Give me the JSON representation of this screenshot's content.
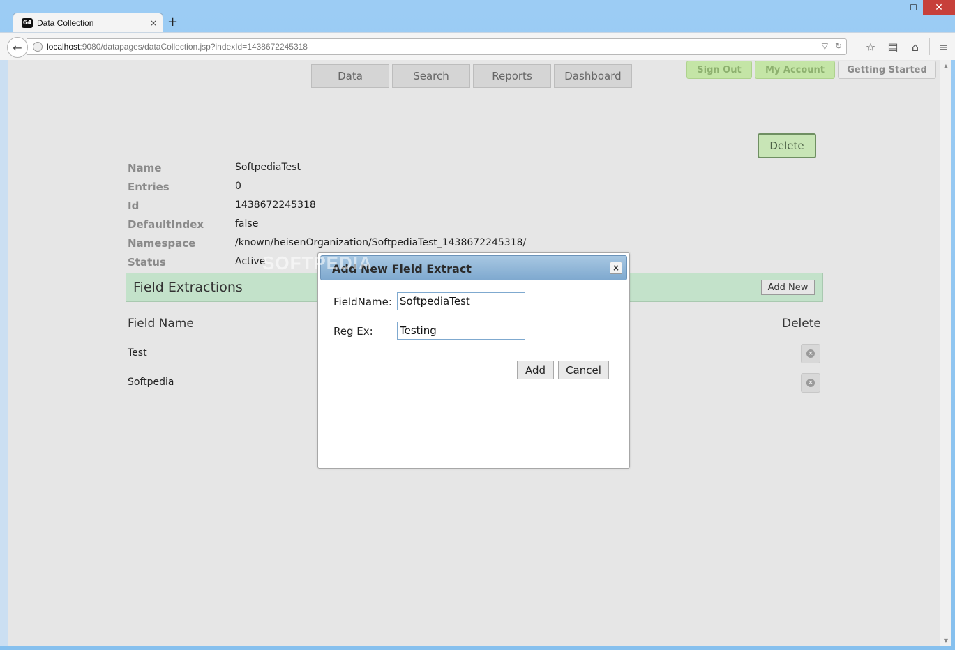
{
  "browser": {
    "tab_title": "Data Collection",
    "tab_favicon_text": "64",
    "new_tab": "+",
    "tab_close": "×",
    "url_host": "localhost",
    "url_rest": ":9080/datapages/dataCollection.jsp?indexId=1438672245318",
    "window_controls": {
      "minimize": "‒",
      "maximize": "☐",
      "close": "✕"
    }
  },
  "nav": {
    "tabs": [
      "Data",
      "Search",
      "Reports",
      "Dashboard"
    ],
    "sign_out": "Sign Out",
    "my_account": "My Account",
    "getting_started": "Getting Started"
  },
  "index": {
    "delete_label": "Delete",
    "rows": [
      {
        "label": "Name",
        "value": "SoftpediaTest"
      },
      {
        "label": "Entries",
        "value": "0"
      },
      {
        "label": "Id",
        "value": "1438672245318"
      },
      {
        "label": "DefaultIndex",
        "value": "false"
      },
      {
        "label": "Namespace",
        "value": "/known/heisenOrganization/SoftpediaTest_1438672245318/"
      },
      {
        "label": "Status",
        "value": "Active"
      }
    ]
  },
  "field_extractions": {
    "title": "Field Extractions",
    "add_new": "Add New",
    "col_field_name": "Field Name",
    "col_delete": "Delete",
    "rows": [
      "Test",
      "Softpedia"
    ]
  },
  "modal": {
    "title": "Add New Field Extract",
    "close": "×",
    "fieldname_label": "FieldName:",
    "fieldname_value": "SoftpediaTest",
    "regex_label": "Reg Ex:",
    "regex_value": "Testing",
    "add_label": "Add",
    "cancel_label": "Cancel"
  },
  "watermark": "SOFTPEDIA",
  "icons": {
    "back": "back-arrow-icon",
    "globe": "globe-icon",
    "dropdown": "dropdown-arrow-icon",
    "reload": "reload-icon",
    "bookmark": "star-icon",
    "reading_list": "reading-list-icon",
    "home": "home-icon",
    "menu": "hamburger-menu-icon",
    "row_delete": "remove-circle-icon"
  },
  "colors": {
    "green_button": "#c4e5a6",
    "field_bar": "#c3e2ca",
    "modal_header": "#7fa9cf",
    "page_bg": "#e6e6e6"
  }
}
